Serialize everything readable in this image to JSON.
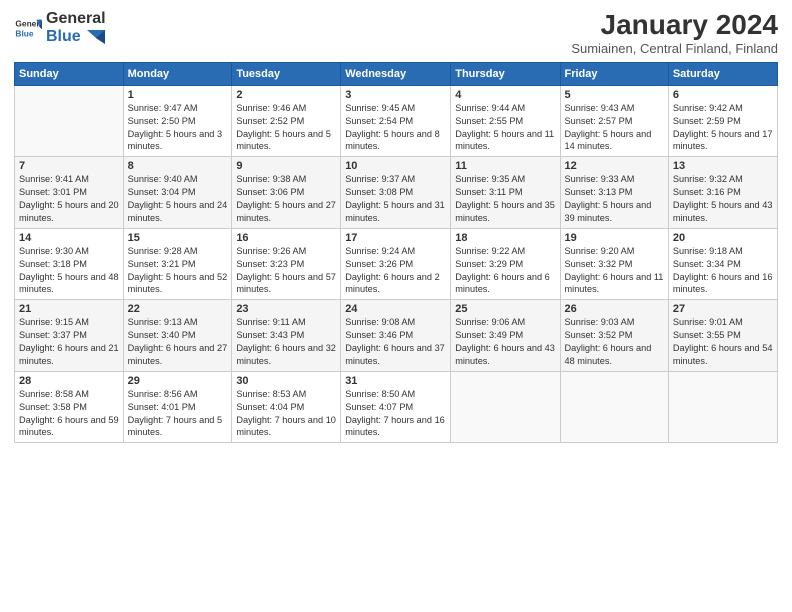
{
  "header": {
    "logo_general": "General",
    "logo_blue": "Blue",
    "title": "January 2024",
    "subtitle": "Sumiainen, Central Finland, Finland"
  },
  "weekdays": [
    "Sunday",
    "Monday",
    "Tuesday",
    "Wednesday",
    "Thursday",
    "Friday",
    "Saturday"
  ],
  "weeks": [
    [
      {
        "day": "",
        "sunrise": "",
        "sunset": "",
        "daylight": ""
      },
      {
        "day": "1",
        "sunrise": "9:47 AM",
        "sunset": "2:50 PM",
        "daylight": "5 hours and 3 minutes."
      },
      {
        "day": "2",
        "sunrise": "9:46 AM",
        "sunset": "2:52 PM",
        "daylight": "5 hours and 5 minutes."
      },
      {
        "day": "3",
        "sunrise": "9:45 AM",
        "sunset": "2:54 PM",
        "daylight": "5 hours and 8 minutes."
      },
      {
        "day": "4",
        "sunrise": "9:44 AM",
        "sunset": "2:55 PM",
        "daylight": "5 hours and 11 minutes."
      },
      {
        "day": "5",
        "sunrise": "9:43 AM",
        "sunset": "2:57 PM",
        "daylight": "5 hours and 14 minutes."
      },
      {
        "day": "6",
        "sunrise": "9:42 AM",
        "sunset": "2:59 PM",
        "daylight": "5 hours and 17 minutes."
      }
    ],
    [
      {
        "day": "7",
        "sunrise": "9:41 AM",
        "sunset": "3:01 PM",
        "daylight": "5 hours and 20 minutes."
      },
      {
        "day": "8",
        "sunrise": "9:40 AM",
        "sunset": "3:04 PM",
        "daylight": "5 hours and 24 minutes."
      },
      {
        "day": "9",
        "sunrise": "9:38 AM",
        "sunset": "3:06 PM",
        "daylight": "5 hours and 27 minutes."
      },
      {
        "day": "10",
        "sunrise": "9:37 AM",
        "sunset": "3:08 PM",
        "daylight": "5 hours and 31 minutes."
      },
      {
        "day": "11",
        "sunrise": "9:35 AM",
        "sunset": "3:11 PM",
        "daylight": "5 hours and 35 minutes."
      },
      {
        "day": "12",
        "sunrise": "9:33 AM",
        "sunset": "3:13 PM",
        "daylight": "5 hours and 39 minutes."
      },
      {
        "day": "13",
        "sunrise": "9:32 AM",
        "sunset": "3:16 PM",
        "daylight": "5 hours and 43 minutes."
      }
    ],
    [
      {
        "day": "14",
        "sunrise": "9:30 AM",
        "sunset": "3:18 PM",
        "daylight": "5 hours and 48 minutes."
      },
      {
        "day": "15",
        "sunrise": "9:28 AM",
        "sunset": "3:21 PM",
        "daylight": "5 hours and 52 minutes."
      },
      {
        "day": "16",
        "sunrise": "9:26 AM",
        "sunset": "3:23 PM",
        "daylight": "5 hours and 57 minutes."
      },
      {
        "day": "17",
        "sunrise": "9:24 AM",
        "sunset": "3:26 PM",
        "daylight": "6 hours and 2 minutes."
      },
      {
        "day": "18",
        "sunrise": "9:22 AM",
        "sunset": "3:29 PM",
        "daylight": "6 hours and 6 minutes."
      },
      {
        "day": "19",
        "sunrise": "9:20 AM",
        "sunset": "3:32 PM",
        "daylight": "6 hours and 11 minutes."
      },
      {
        "day": "20",
        "sunrise": "9:18 AM",
        "sunset": "3:34 PM",
        "daylight": "6 hours and 16 minutes."
      }
    ],
    [
      {
        "day": "21",
        "sunrise": "9:15 AM",
        "sunset": "3:37 PM",
        "daylight": "6 hours and 21 minutes."
      },
      {
        "day": "22",
        "sunrise": "9:13 AM",
        "sunset": "3:40 PM",
        "daylight": "6 hours and 27 minutes."
      },
      {
        "day": "23",
        "sunrise": "9:11 AM",
        "sunset": "3:43 PM",
        "daylight": "6 hours and 32 minutes."
      },
      {
        "day": "24",
        "sunrise": "9:08 AM",
        "sunset": "3:46 PM",
        "daylight": "6 hours and 37 minutes."
      },
      {
        "day": "25",
        "sunrise": "9:06 AM",
        "sunset": "3:49 PM",
        "daylight": "6 hours and 43 minutes."
      },
      {
        "day": "26",
        "sunrise": "9:03 AM",
        "sunset": "3:52 PM",
        "daylight": "6 hours and 48 minutes."
      },
      {
        "day": "27",
        "sunrise": "9:01 AM",
        "sunset": "3:55 PM",
        "daylight": "6 hours and 54 minutes."
      }
    ],
    [
      {
        "day": "28",
        "sunrise": "8:58 AM",
        "sunset": "3:58 PM",
        "daylight": "6 hours and 59 minutes."
      },
      {
        "day": "29",
        "sunrise": "8:56 AM",
        "sunset": "4:01 PM",
        "daylight": "7 hours and 5 minutes."
      },
      {
        "day": "30",
        "sunrise": "8:53 AM",
        "sunset": "4:04 PM",
        "daylight": "7 hours and 10 minutes."
      },
      {
        "day": "31",
        "sunrise": "8:50 AM",
        "sunset": "4:07 PM",
        "daylight": "7 hours and 16 minutes."
      },
      {
        "day": "",
        "sunrise": "",
        "sunset": "",
        "daylight": ""
      },
      {
        "day": "",
        "sunrise": "",
        "sunset": "",
        "daylight": ""
      },
      {
        "day": "",
        "sunrise": "",
        "sunset": "",
        "daylight": ""
      }
    ]
  ]
}
